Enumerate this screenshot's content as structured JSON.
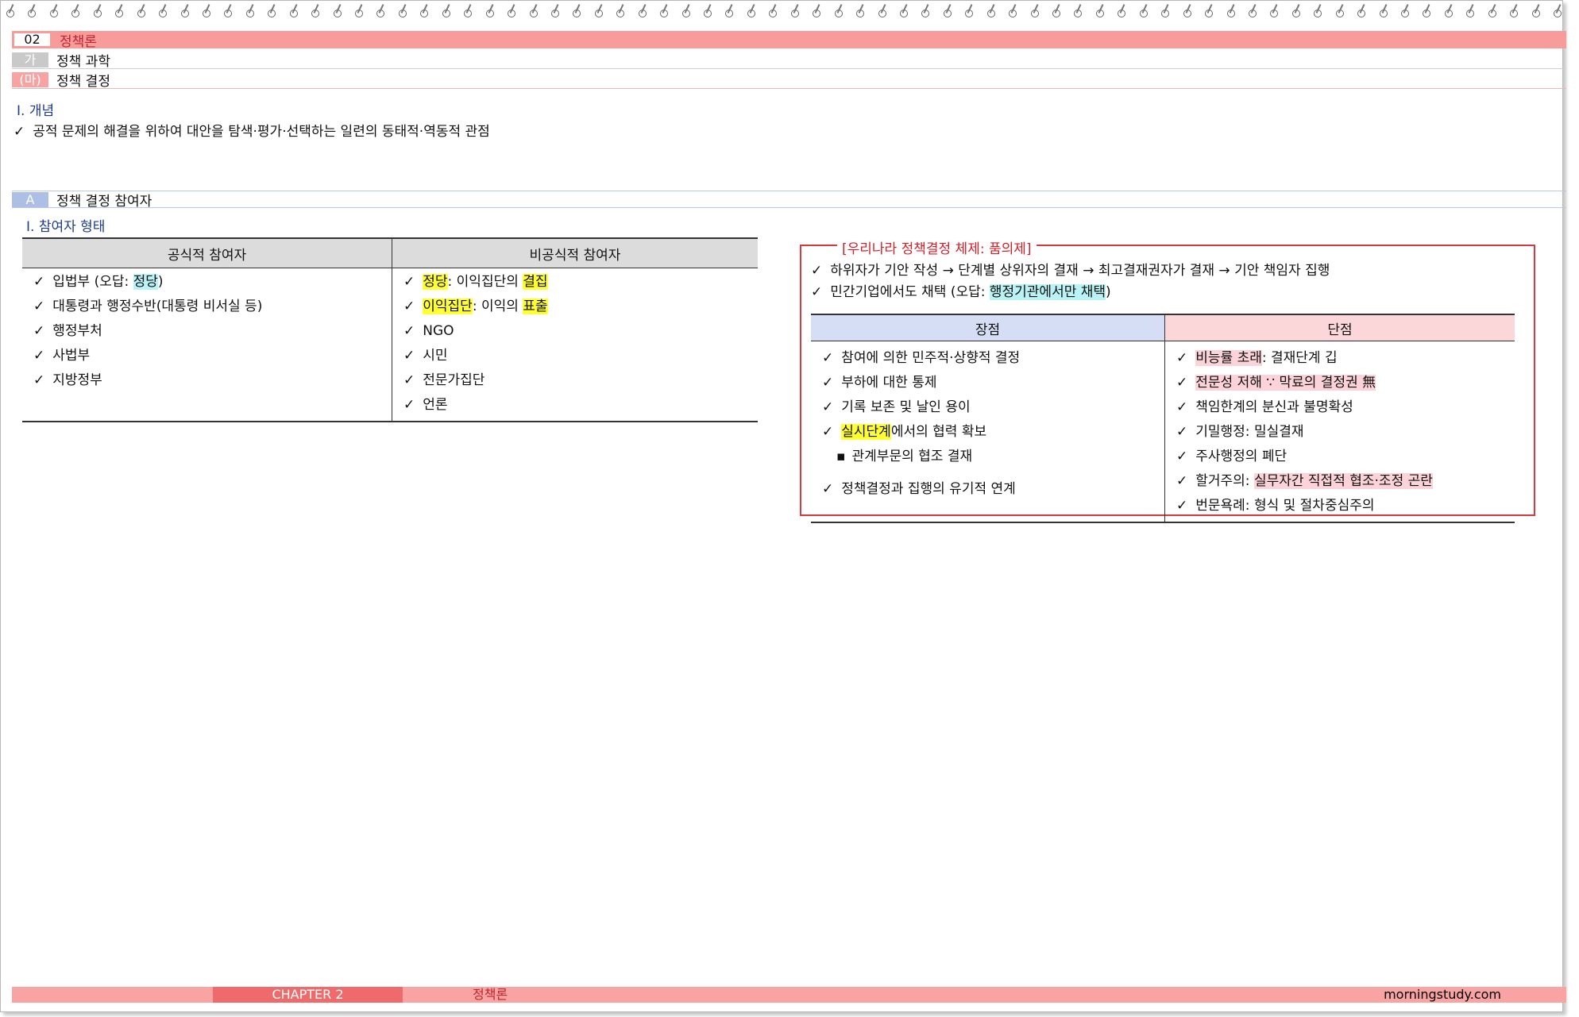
{
  "header": {
    "chapter_num": "02",
    "chapter_title": "정책론",
    "section_tag": "가",
    "section_title": "정책 과학",
    "sub_tag": "(마)",
    "sub_title": "정책 결정"
  },
  "concept": {
    "heading": "Ⅰ. 개념",
    "check": "✓",
    "text": "공적 문제의 해결을 위하여 대안을 탐색·평가·선택하는 일련의 동태적·역동적 관점"
  },
  "section_a": {
    "tag": "A",
    "title": "정책 결정 참여자",
    "heading": "Ⅰ. 참여자 형태"
  },
  "participants": {
    "headers": [
      "공식적 참여자",
      "비공식적 참여자"
    ],
    "official": [
      {
        "pre": "입법부 (오답: ",
        "hl": "정당",
        "post": ")"
      },
      {
        "pre": "대통령과 행정수반(대통령 비서실 등)",
        "hl": "",
        "post": ""
      },
      {
        "pre": "행정부처",
        "hl": "",
        "post": ""
      },
      {
        "pre": "사법부",
        "hl": "",
        "post": ""
      },
      {
        "pre": "지방정부",
        "hl": "",
        "post": ""
      }
    ],
    "unofficial": [
      {
        "a": "정당",
        "b": ": 이익집단의 ",
        "c": "결집"
      },
      {
        "a": "이익집단",
        "b": ": 이익의 ",
        "c": "표출"
      },
      {
        "a": "",
        "b": "NGO",
        "c": ""
      },
      {
        "a": "",
        "b": "시민",
        "c": ""
      },
      {
        "a": "",
        "b": "전문가집단",
        "c": ""
      },
      {
        "a": "",
        "b": "언론",
        "c": ""
      }
    ]
  },
  "pumui": {
    "title": "[우리나라 정책결정 체제: 품의제]",
    "line1": "하위자가 기안 작성 → 단계별 상위자의 결재 → 최고결재권자가 결재 → 기안 책임자 집행",
    "line2_pre": "민간기업에서도 채택 (오답: ",
    "line2_hl": "행정기관에서만 채택",
    "line2_post": ")",
    "headers": [
      "장점",
      "단점"
    ],
    "advantages": {
      "a1": "참여에 의한 민주적·상향적 결정",
      "a2": "부하에 대한 통제",
      "a3": "기록 보존 및 날인 용이",
      "a4_hl": "실시단계",
      "a4_post": "에서의 협력 확보",
      "a5_bullet": "▪",
      "a5": "관계부문의 협조 결재",
      "a6": "정책결정과 집행의 유기적 연계"
    },
    "disadvantages": {
      "d1_hl": "비능률 초래",
      "d1_post": ": 결재단계 깁",
      "d2_hl": "전문성 저해  ∵ 막료의 결정권 無",
      "d3": "책임한계의 분신과 불명확성",
      "d4": "기밀행정: 밀실결재",
      "d5": "주사행정의 폐단",
      "d6_pre": "할거주의: ",
      "d6_hl": "실무자간 직접적 협조·조정 곤란",
      "d7": "번문욕례: 형식 및 절차중심주의"
    }
  },
  "footer": {
    "chapter": "CHAPTER 2",
    "title": "정책론",
    "site": "morningstudy.com"
  }
}
